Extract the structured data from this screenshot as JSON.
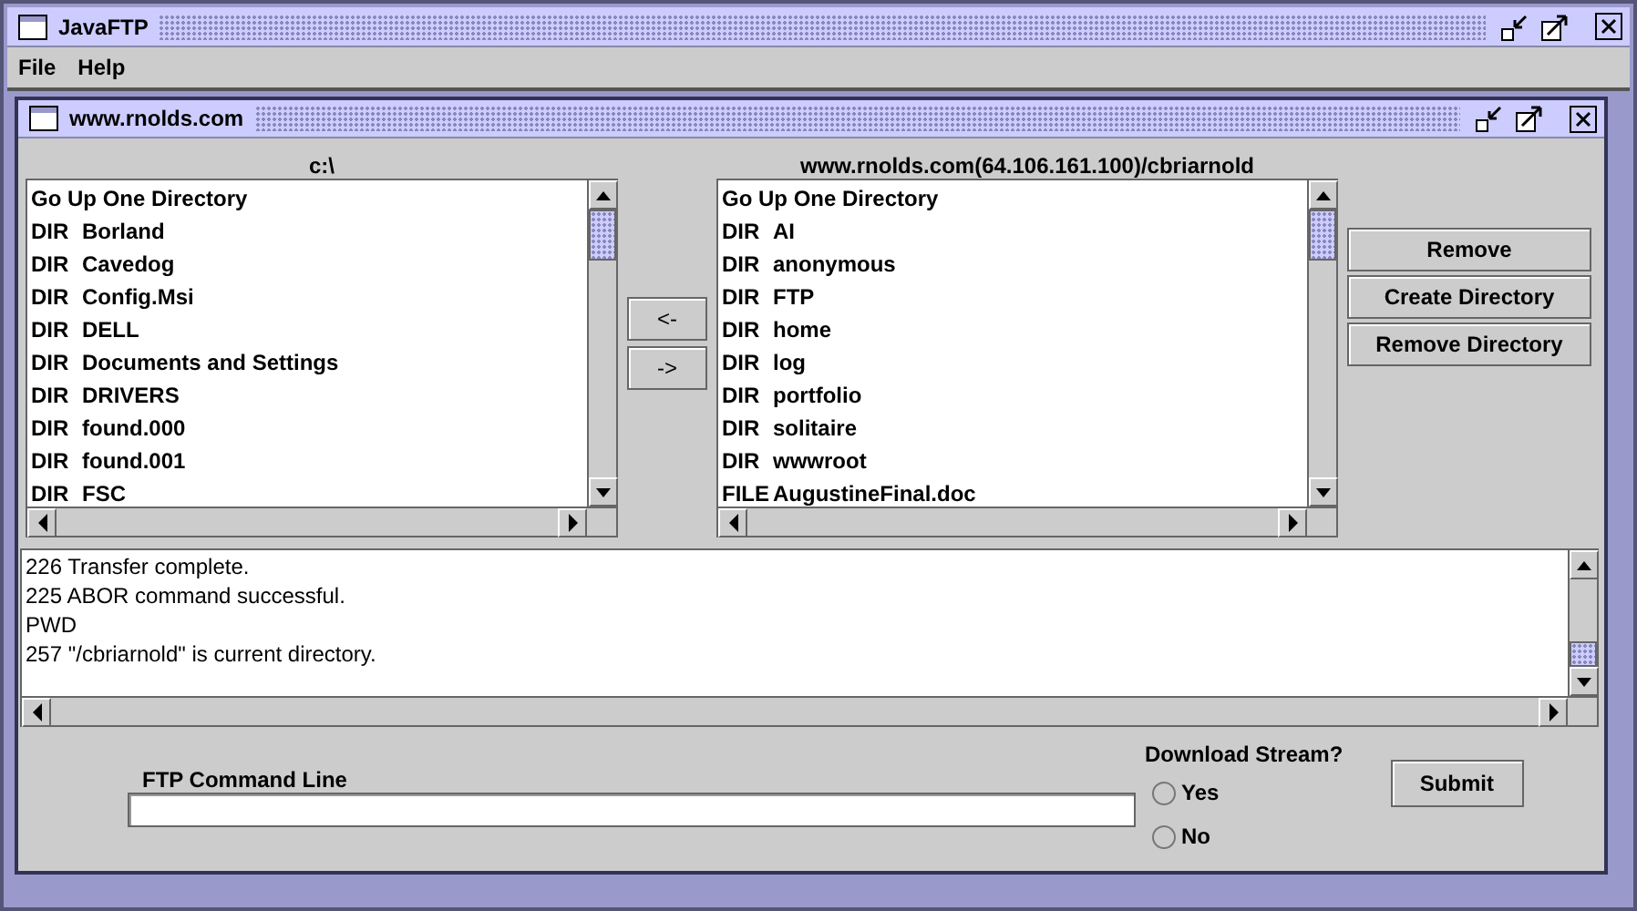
{
  "window": {
    "title": "JavaFTP"
  },
  "menu": [
    "File",
    "Help"
  ],
  "internal_window": {
    "title": "www.rnolds.com"
  },
  "local": {
    "path": "c:\\",
    "items": [
      {
        "kind": "up",
        "name": "Go Up One Directory"
      },
      {
        "kind": "entry",
        "type": "DIR",
        "name": "Borland"
      },
      {
        "kind": "entry",
        "type": "DIR",
        "name": "Cavedog"
      },
      {
        "kind": "entry",
        "type": "DIR",
        "name": "Config.Msi"
      },
      {
        "kind": "entry",
        "type": "DIR",
        "name": "DELL"
      },
      {
        "kind": "entry",
        "type": "DIR",
        "name": "Documents and Settings"
      },
      {
        "kind": "entry",
        "type": "DIR",
        "name": "DRIVERS"
      },
      {
        "kind": "entry",
        "type": "DIR",
        "name": "found.000"
      },
      {
        "kind": "entry",
        "type": "DIR",
        "name": "found.001"
      },
      {
        "kind": "entry",
        "type": "DIR",
        "name": "FSC"
      }
    ]
  },
  "transfer_buttons": [
    "<-",
    "->"
  ],
  "remote": {
    "path": "www.rnolds.com(64.106.161.100)/cbriarnold",
    "items": [
      {
        "kind": "up",
        "name": "Go Up One Directory"
      },
      {
        "kind": "entry",
        "type": "DIR",
        "name": "AI"
      },
      {
        "kind": "entry",
        "type": "DIR",
        "name": "anonymous"
      },
      {
        "kind": "entry",
        "type": "DIR",
        "name": "FTP"
      },
      {
        "kind": "entry",
        "type": "DIR",
        "name": "home"
      },
      {
        "kind": "entry",
        "type": "DIR",
        "name": "log"
      },
      {
        "kind": "entry",
        "type": "DIR",
        "name": "portfolio"
      },
      {
        "kind": "entry",
        "type": "DIR",
        "name": "solitaire"
      },
      {
        "kind": "entry",
        "type": "DIR",
        "name": "wwwroot"
      },
      {
        "kind": "entry",
        "type": "FILE",
        "name": "AugustineFinal.doc"
      }
    ]
  },
  "action_buttons": [
    "Remove",
    "Create Directory",
    "Remove Directory"
  ],
  "log": [
    "226 Transfer complete.",
    "225 ABOR command successful.",
    "PWD",
    "257 \"/cbriarnold\" is current directory."
  ],
  "command_line": {
    "label": "FTP Command Line"
  },
  "download_stream": {
    "label": "Download Stream?",
    "options": [
      {
        "label": "Yes",
        "selected": false
      },
      {
        "label": "No",
        "selected": false
      }
    ]
  },
  "submit_button": "Submit"
}
